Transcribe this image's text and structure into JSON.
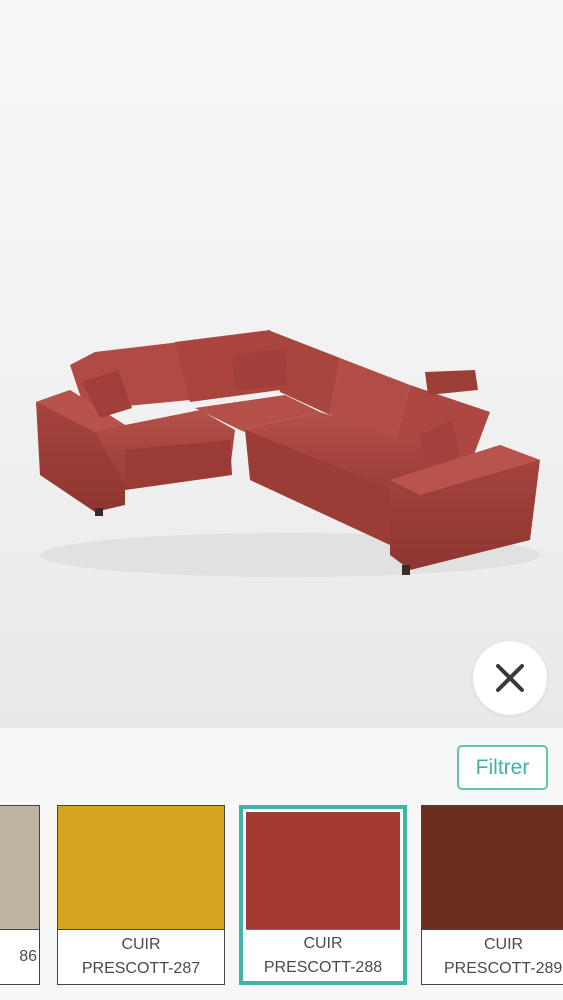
{
  "viewer": {
    "product": "corner-sofa",
    "close_icon": "close-icon"
  },
  "toolbar": {
    "filter_label": "Filtrer"
  },
  "colors": {
    "accent": "#3fb5a5"
  },
  "swatches": [
    {
      "line1": "",
      "line2": "86",
      "color": "#bfb3a2",
      "selected": false
    },
    {
      "line1": "CUIR",
      "line2": "PRESCOTT-287",
      "color": "#d6a51f",
      "selected": false
    },
    {
      "line1": "CUIR",
      "line2": "PRESCOTT-288",
      "color": "#a33a30",
      "selected": true
    },
    {
      "line1": "CUIR",
      "line2": "PRESCOTT-289",
      "color": "#6b2d1c",
      "selected": false
    }
  ]
}
